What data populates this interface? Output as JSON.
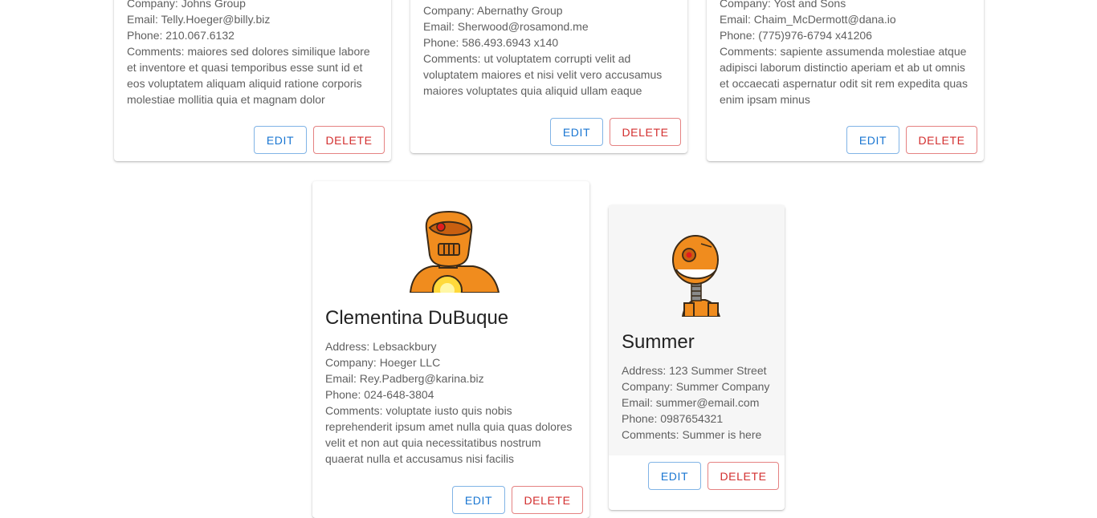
{
  "colors": {
    "edit": "#1976d2",
    "delete": "#d32f2f",
    "robot_orange": "#f08c1e",
    "robot_outline": "#3a2a18"
  },
  "buttons": {
    "edit_label": "EDIT",
    "delete_label": "DELETE"
  },
  "contacts": [
    {
      "name": "",
      "address": "",
      "company": "Company: Johns Group",
      "email": "Email: Telly.Hoeger@billy.biz",
      "phone": "Phone: 210.067.6132",
      "comments": "Comments: maiores sed dolores similique labore et inventore et quasi temporibus esse sunt id et eos voluptatem aliquam aliquid ratione corporis molestiae mollitia quia et magnam dolor"
    },
    {
      "name": "",
      "address": "",
      "company": "Company: Abernathy Group",
      "email": "Email: Sherwood@rosamond.me",
      "phone": "Phone: 586.493.6943 x140",
      "comments": "Comments: ut voluptatem corrupti velit ad voluptatem maiores et nisi velit vero accusamus maiores voluptates quia aliquid ullam eaque"
    },
    {
      "name": "",
      "address": "",
      "company": "Company: Yost and Sons",
      "email": "Email: Chaim_McDermott@dana.io",
      "phone": "Phone: (775)976-6794 x41206",
      "comments": "Comments: sapiente assumenda molestiae atque adipisci laborum distinctio aperiam et ab ut omnis et occaecati aspernatur odit sit rem expedita quas enim ipsam minus"
    },
    {
      "name": "Clementina DuBuque",
      "avatar": "robot-avatar-icon",
      "address": "Address: Lebsackbury",
      "company": "Company: Hoeger LLC",
      "email": "Email: Rey.Padberg@karina.biz",
      "phone": "Phone: 024-648-3804",
      "comments": "Comments: voluptate iusto quis nobis reprehenderit ipsum amet nulla quia quas dolores velit et non aut quia necessitatibus nostrum quaerat nulla et accusamus nisi facilis"
    },
    {
      "name": "Summer",
      "avatar": "robot-avatar-icon",
      "address": "Address: 123 Summer Street",
      "company": "Company: Summer Company",
      "email": "Email: summer@email.com",
      "phone": "Phone: 0987654321",
      "comments": "Comments: Summer is here"
    }
  ]
}
